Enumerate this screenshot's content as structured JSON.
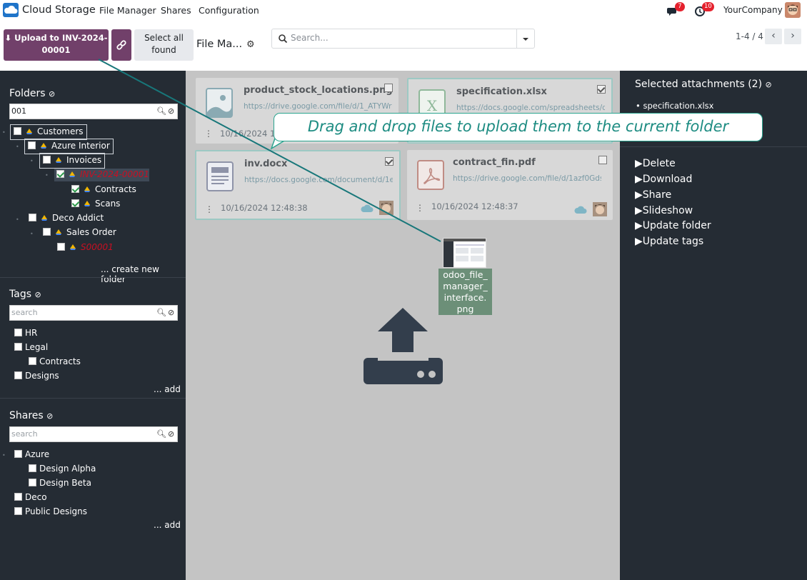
{
  "navbar": {
    "app_title": "Cloud Storage",
    "menu": [
      "File Manager",
      "Shares",
      "Configuration"
    ],
    "messages_count": "7",
    "activities_count": "10",
    "company": "YourCompany"
  },
  "control_panel": {
    "upload_button": "Upload to INV-2024-00001",
    "select_all_button": "Select all found",
    "breadcrumb": "File Ma...",
    "search_placeholder": "Search...",
    "pager": "1-4 / 4"
  },
  "sidebar": {
    "folders": {
      "title": "Folders",
      "filter_value": "001",
      "tree": [
        {
          "label": "Customers",
          "checked": false
        },
        {
          "label": "Azure Interior",
          "checked": false
        },
        {
          "label": "Invoices",
          "checked": false
        },
        {
          "label": "INV-2024-00001",
          "checked": true
        },
        {
          "label": "Contracts",
          "checked": true
        },
        {
          "label": "Scans",
          "checked": true
        },
        {
          "label": "Deco Addict",
          "checked": false
        },
        {
          "label": "Sales Order",
          "checked": false
        },
        {
          "label": "S00001",
          "checked": false
        }
      ],
      "create_link": "... create new folder"
    },
    "tags": {
      "title": "Tags",
      "search_placeholder": "search",
      "items": [
        "HR",
        "Legal",
        "Contracts",
        "Designs"
      ],
      "add_link": "... add"
    },
    "shares": {
      "title": "Shares",
      "search_placeholder": "search",
      "items": [
        "Azure",
        "Design Alpha",
        "Design Beta",
        "Deco",
        "Public Designs"
      ],
      "add_link": "... add"
    }
  },
  "files": [
    {
      "name": "product_stock_locations.png",
      "url": "https://drive.google.com/file/d/1_ATYWr",
      "date": "10/16/2024 12",
      "selected": false,
      "type": "image"
    },
    {
      "name": "specification.xlsx",
      "url": "https://docs.google.com/spreadsheets/d",
      "date": "",
      "selected": true,
      "type": "spreadsheet"
    },
    {
      "name": "inv.docx",
      "url": "https://docs.google.com/document/d/1e",
      "date": "10/16/2024 12:48:38",
      "selected": true,
      "type": "document"
    },
    {
      "name": "contract_fin.pdf",
      "url": "https://drive.google.com/file/d/1azf0Gds",
      "date": "10/16/2024 12:48:37",
      "selected": false,
      "type": "pdf"
    }
  ],
  "drag_item": {
    "label": "odoo_file_ manager_ interface. png"
  },
  "right_panel": {
    "title": "Selected attachments (2)",
    "selected": [
      "specification.xlsx"
    ],
    "actions": [
      "Delete",
      "Download",
      "Share",
      "Slideshow",
      "Update folder",
      "Update tags"
    ]
  },
  "callout": {
    "text": "Drag and drop files to upload them to the current folder"
  },
  "colors": {
    "primary": "#71406a",
    "sidebar": "#252c34",
    "callout": "#2ba48f",
    "main_bg": "#c4c4c4"
  }
}
